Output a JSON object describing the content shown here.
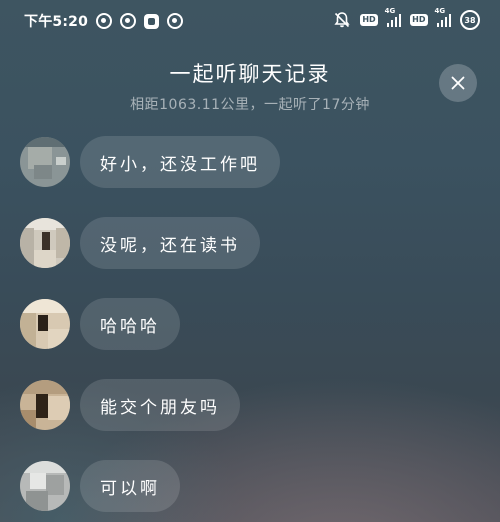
{
  "status_bar": {
    "time": "下午5:20",
    "app_icons": [
      "netease-music-icon",
      "netease-music-icon",
      "settings-square-icon",
      "netease-music-icon"
    ],
    "hd_label": "HD",
    "network_label": "4G",
    "battery_level": "38"
  },
  "header": {
    "title": "一起听聊天记录",
    "subtitle": "相距1063.11公里，一起听了17分钟",
    "close_icon": "close-icon"
  },
  "messages": [
    {
      "text": "好小，还没工作吧"
    },
    {
      "text": "没呢，还在读书"
    },
    {
      "text": "哈哈哈"
    },
    {
      "text": "能交个朋友吗"
    },
    {
      "text": "可以啊"
    }
  ]
}
